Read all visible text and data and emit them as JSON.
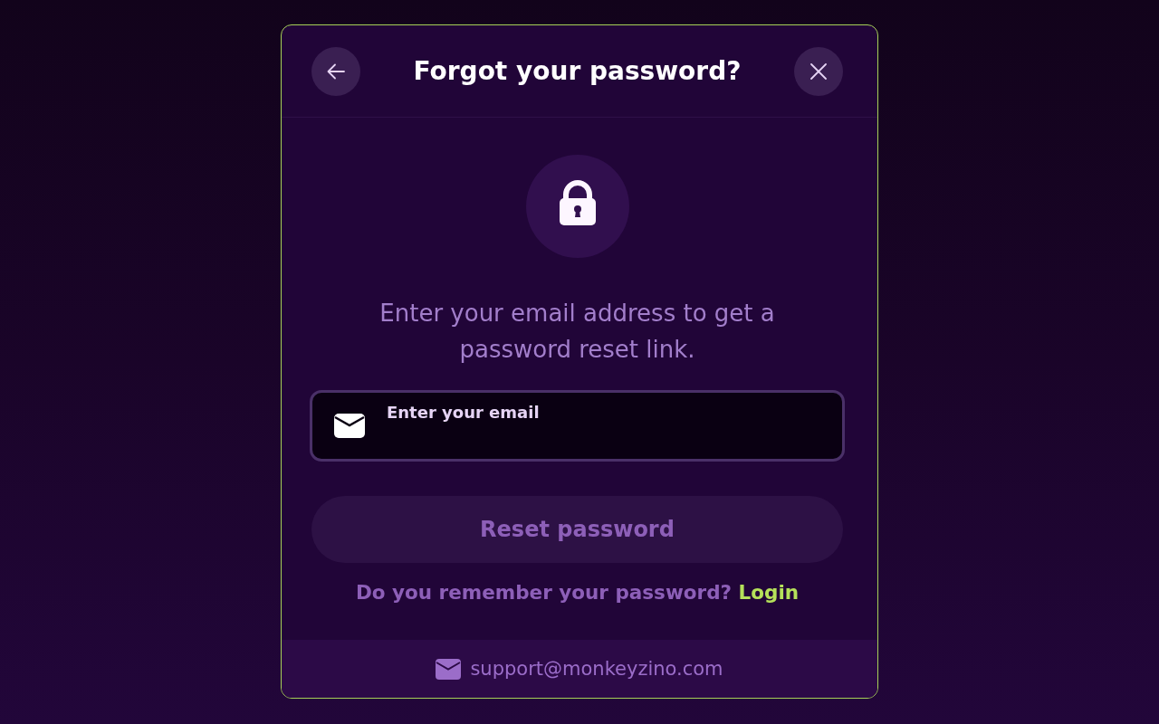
{
  "dialog": {
    "title": "Forgot your password?",
    "message": "Enter your email address to get a password reset link.",
    "email_field": {
      "placeholder": "Enter your email"
    },
    "reset_button": {
      "label": "Reset password",
      "disabled": true
    },
    "login_prompt": {
      "text": "Do you remember your password?",
      "link": "Login"
    },
    "footer": {
      "support_email": "support@monkeyzino.com"
    }
  }
}
